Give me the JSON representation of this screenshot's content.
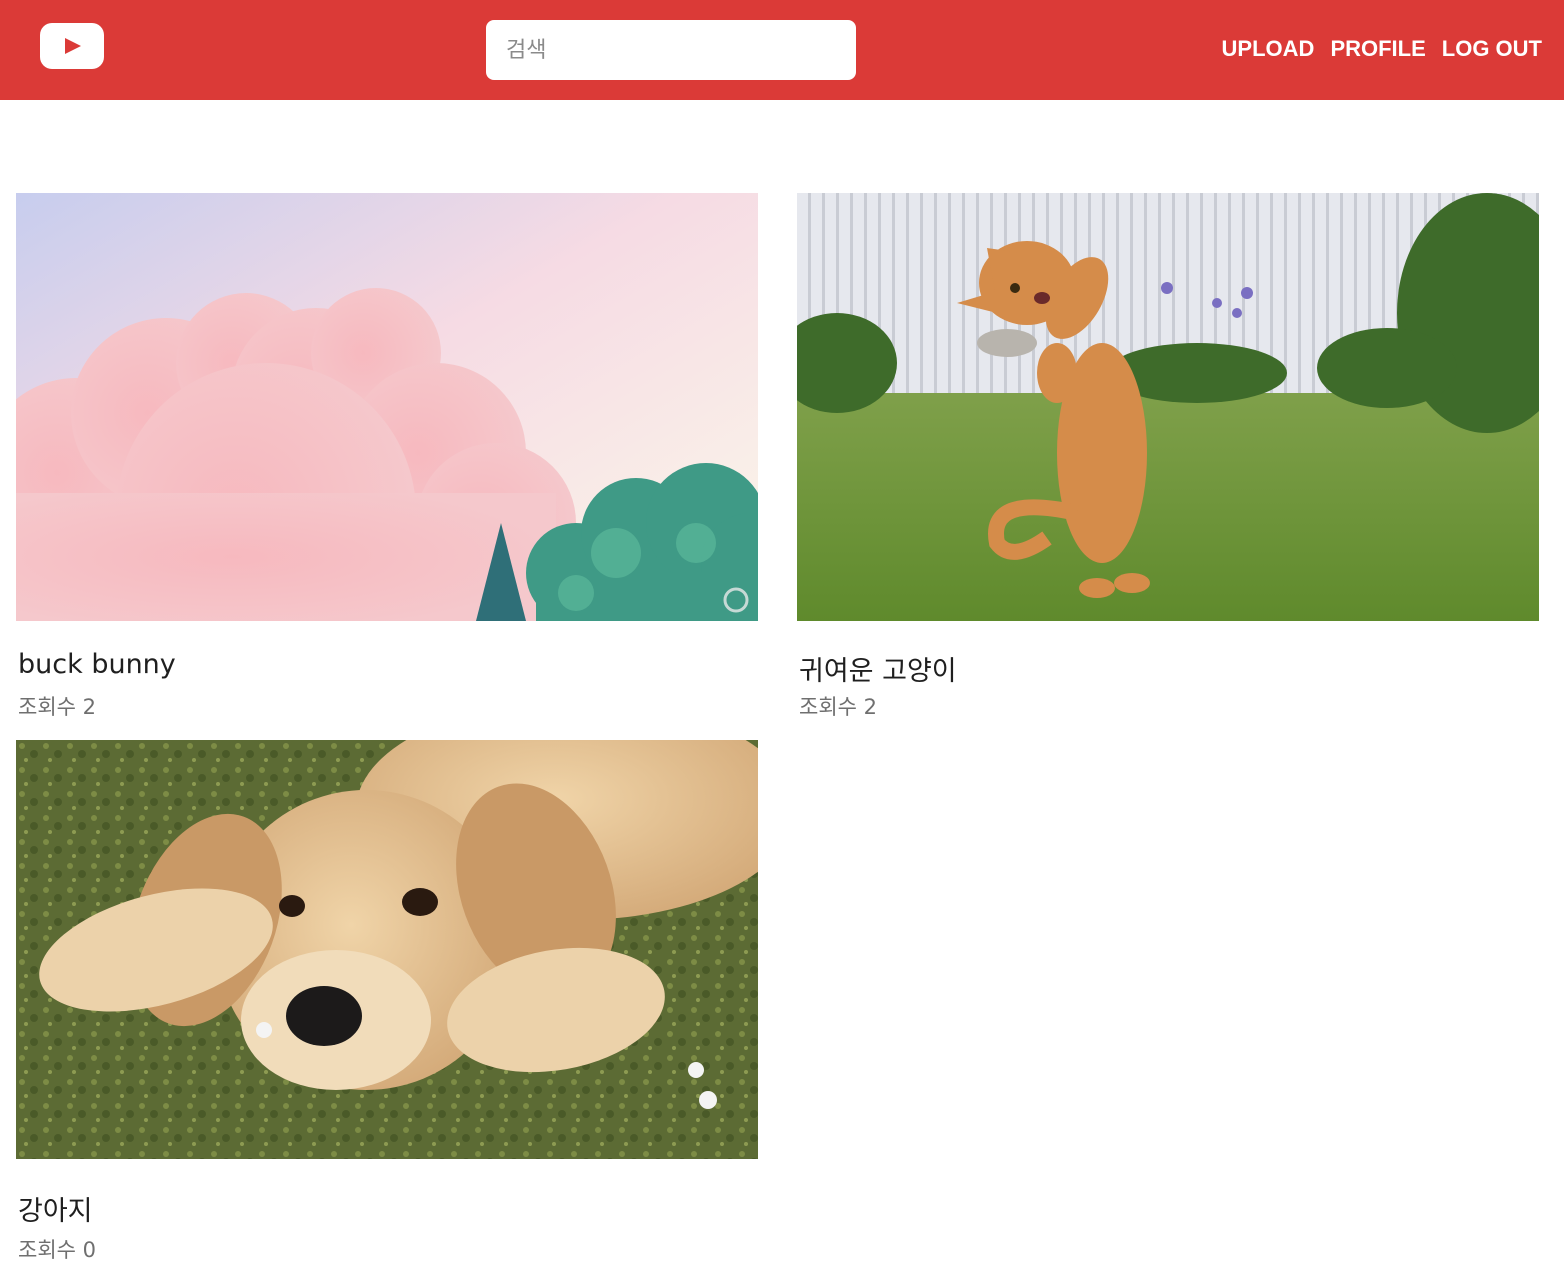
{
  "header": {
    "logo_icon": "youtube-play-icon",
    "brand_color": "#db3a37",
    "search_placeholder": "검색",
    "nav": {
      "upload": "UPLOAD",
      "profile": "PROFILE",
      "logout": "LOG OUT"
    }
  },
  "videos": [
    {
      "title": "buck bunny",
      "views": "조회수 2",
      "thumbnail": "pink clouds and trees scene"
    },
    {
      "title": "귀여운 고양이",
      "views": "조회수 2",
      "thumbnail": "orange cat jumping on grass"
    },
    {
      "title": "강아지",
      "views": "조회수 0",
      "thumbnail": "golden retriever puppy lying on grass"
    }
  ]
}
